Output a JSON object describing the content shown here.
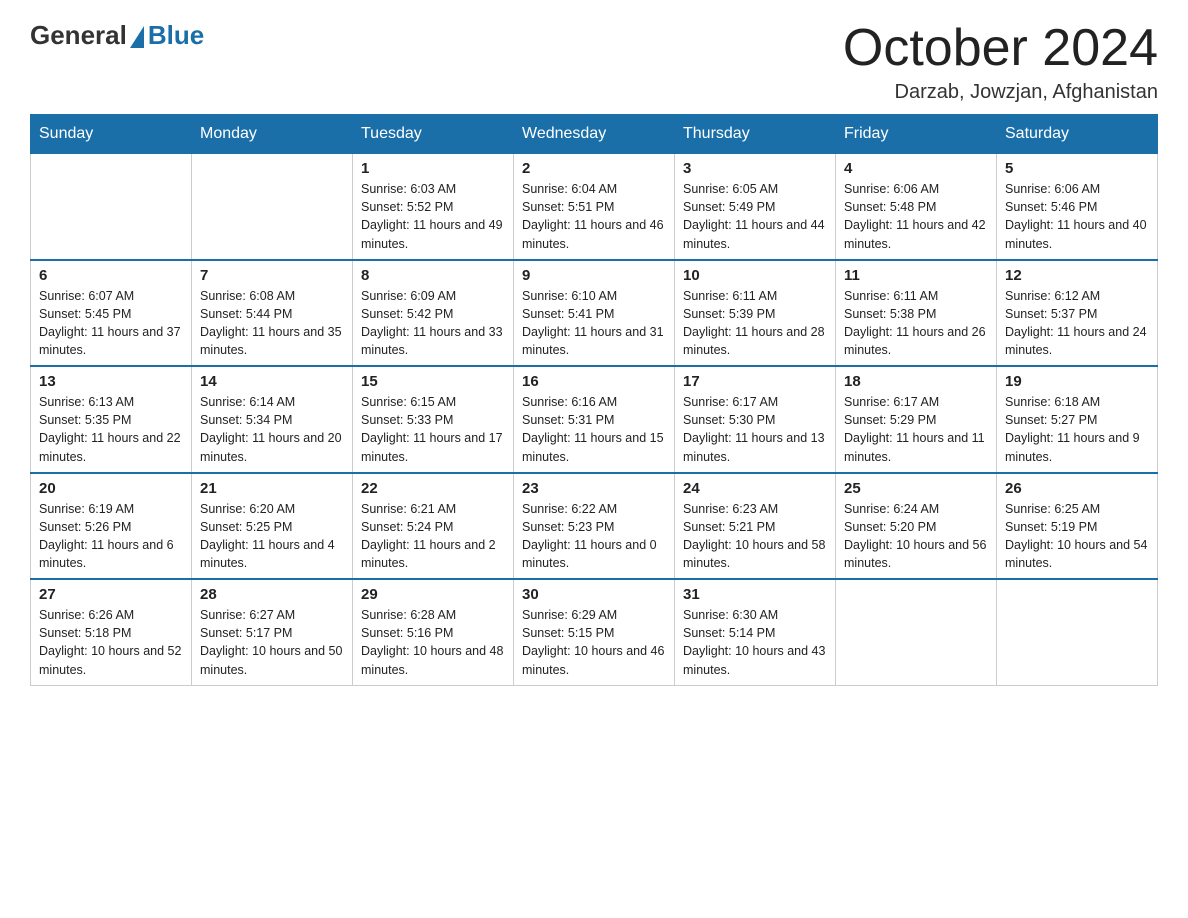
{
  "header": {
    "title": "October 2024",
    "location": "Darzab, Jowzjan, Afghanistan",
    "logo": {
      "general": "General",
      "blue": "Blue"
    }
  },
  "days_of_week": [
    "Sunday",
    "Monday",
    "Tuesday",
    "Wednesday",
    "Thursday",
    "Friday",
    "Saturday"
  ],
  "weeks": [
    [
      {
        "day": "",
        "sunrise": "",
        "sunset": "",
        "daylight": ""
      },
      {
        "day": "",
        "sunrise": "",
        "sunset": "",
        "daylight": ""
      },
      {
        "day": "1",
        "sunrise": "Sunrise: 6:03 AM",
        "sunset": "Sunset: 5:52 PM",
        "daylight": "Daylight: 11 hours and 49 minutes."
      },
      {
        "day": "2",
        "sunrise": "Sunrise: 6:04 AM",
        "sunset": "Sunset: 5:51 PM",
        "daylight": "Daylight: 11 hours and 46 minutes."
      },
      {
        "day": "3",
        "sunrise": "Sunrise: 6:05 AM",
        "sunset": "Sunset: 5:49 PM",
        "daylight": "Daylight: 11 hours and 44 minutes."
      },
      {
        "day": "4",
        "sunrise": "Sunrise: 6:06 AM",
        "sunset": "Sunset: 5:48 PM",
        "daylight": "Daylight: 11 hours and 42 minutes."
      },
      {
        "day": "5",
        "sunrise": "Sunrise: 6:06 AM",
        "sunset": "Sunset: 5:46 PM",
        "daylight": "Daylight: 11 hours and 40 minutes."
      }
    ],
    [
      {
        "day": "6",
        "sunrise": "Sunrise: 6:07 AM",
        "sunset": "Sunset: 5:45 PM",
        "daylight": "Daylight: 11 hours and 37 minutes."
      },
      {
        "day": "7",
        "sunrise": "Sunrise: 6:08 AM",
        "sunset": "Sunset: 5:44 PM",
        "daylight": "Daylight: 11 hours and 35 minutes."
      },
      {
        "day": "8",
        "sunrise": "Sunrise: 6:09 AM",
        "sunset": "Sunset: 5:42 PM",
        "daylight": "Daylight: 11 hours and 33 minutes."
      },
      {
        "day": "9",
        "sunrise": "Sunrise: 6:10 AM",
        "sunset": "Sunset: 5:41 PM",
        "daylight": "Daylight: 11 hours and 31 minutes."
      },
      {
        "day": "10",
        "sunrise": "Sunrise: 6:11 AM",
        "sunset": "Sunset: 5:39 PM",
        "daylight": "Daylight: 11 hours and 28 minutes."
      },
      {
        "day": "11",
        "sunrise": "Sunrise: 6:11 AM",
        "sunset": "Sunset: 5:38 PM",
        "daylight": "Daylight: 11 hours and 26 minutes."
      },
      {
        "day": "12",
        "sunrise": "Sunrise: 6:12 AM",
        "sunset": "Sunset: 5:37 PM",
        "daylight": "Daylight: 11 hours and 24 minutes."
      }
    ],
    [
      {
        "day": "13",
        "sunrise": "Sunrise: 6:13 AM",
        "sunset": "Sunset: 5:35 PM",
        "daylight": "Daylight: 11 hours and 22 minutes."
      },
      {
        "day": "14",
        "sunrise": "Sunrise: 6:14 AM",
        "sunset": "Sunset: 5:34 PM",
        "daylight": "Daylight: 11 hours and 20 minutes."
      },
      {
        "day": "15",
        "sunrise": "Sunrise: 6:15 AM",
        "sunset": "Sunset: 5:33 PM",
        "daylight": "Daylight: 11 hours and 17 minutes."
      },
      {
        "day": "16",
        "sunrise": "Sunrise: 6:16 AM",
        "sunset": "Sunset: 5:31 PM",
        "daylight": "Daylight: 11 hours and 15 minutes."
      },
      {
        "day": "17",
        "sunrise": "Sunrise: 6:17 AM",
        "sunset": "Sunset: 5:30 PM",
        "daylight": "Daylight: 11 hours and 13 minutes."
      },
      {
        "day": "18",
        "sunrise": "Sunrise: 6:17 AM",
        "sunset": "Sunset: 5:29 PM",
        "daylight": "Daylight: 11 hours and 11 minutes."
      },
      {
        "day": "19",
        "sunrise": "Sunrise: 6:18 AM",
        "sunset": "Sunset: 5:27 PM",
        "daylight": "Daylight: 11 hours and 9 minutes."
      }
    ],
    [
      {
        "day": "20",
        "sunrise": "Sunrise: 6:19 AM",
        "sunset": "Sunset: 5:26 PM",
        "daylight": "Daylight: 11 hours and 6 minutes."
      },
      {
        "day": "21",
        "sunrise": "Sunrise: 6:20 AM",
        "sunset": "Sunset: 5:25 PM",
        "daylight": "Daylight: 11 hours and 4 minutes."
      },
      {
        "day": "22",
        "sunrise": "Sunrise: 6:21 AM",
        "sunset": "Sunset: 5:24 PM",
        "daylight": "Daylight: 11 hours and 2 minutes."
      },
      {
        "day": "23",
        "sunrise": "Sunrise: 6:22 AM",
        "sunset": "Sunset: 5:23 PM",
        "daylight": "Daylight: 11 hours and 0 minutes."
      },
      {
        "day": "24",
        "sunrise": "Sunrise: 6:23 AM",
        "sunset": "Sunset: 5:21 PM",
        "daylight": "Daylight: 10 hours and 58 minutes."
      },
      {
        "day": "25",
        "sunrise": "Sunrise: 6:24 AM",
        "sunset": "Sunset: 5:20 PM",
        "daylight": "Daylight: 10 hours and 56 minutes."
      },
      {
        "day": "26",
        "sunrise": "Sunrise: 6:25 AM",
        "sunset": "Sunset: 5:19 PM",
        "daylight": "Daylight: 10 hours and 54 minutes."
      }
    ],
    [
      {
        "day": "27",
        "sunrise": "Sunrise: 6:26 AM",
        "sunset": "Sunset: 5:18 PM",
        "daylight": "Daylight: 10 hours and 52 minutes."
      },
      {
        "day": "28",
        "sunrise": "Sunrise: 6:27 AM",
        "sunset": "Sunset: 5:17 PM",
        "daylight": "Daylight: 10 hours and 50 minutes."
      },
      {
        "day": "29",
        "sunrise": "Sunrise: 6:28 AM",
        "sunset": "Sunset: 5:16 PM",
        "daylight": "Daylight: 10 hours and 48 minutes."
      },
      {
        "day": "30",
        "sunrise": "Sunrise: 6:29 AM",
        "sunset": "Sunset: 5:15 PM",
        "daylight": "Daylight: 10 hours and 46 minutes."
      },
      {
        "day": "31",
        "sunrise": "Sunrise: 6:30 AM",
        "sunset": "Sunset: 5:14 PM",
        "daylight": "Daylight: 10 hours and 43 minutes."
      },
      {
        "day": "",
        "sunrise": "",
        "sunset": "",
        "daylight": ""
      },
      {
        "day": "",
        "sunrise": "",
        "sunset": "",
        "daylight": ""
      }
    ]
  ]
}
